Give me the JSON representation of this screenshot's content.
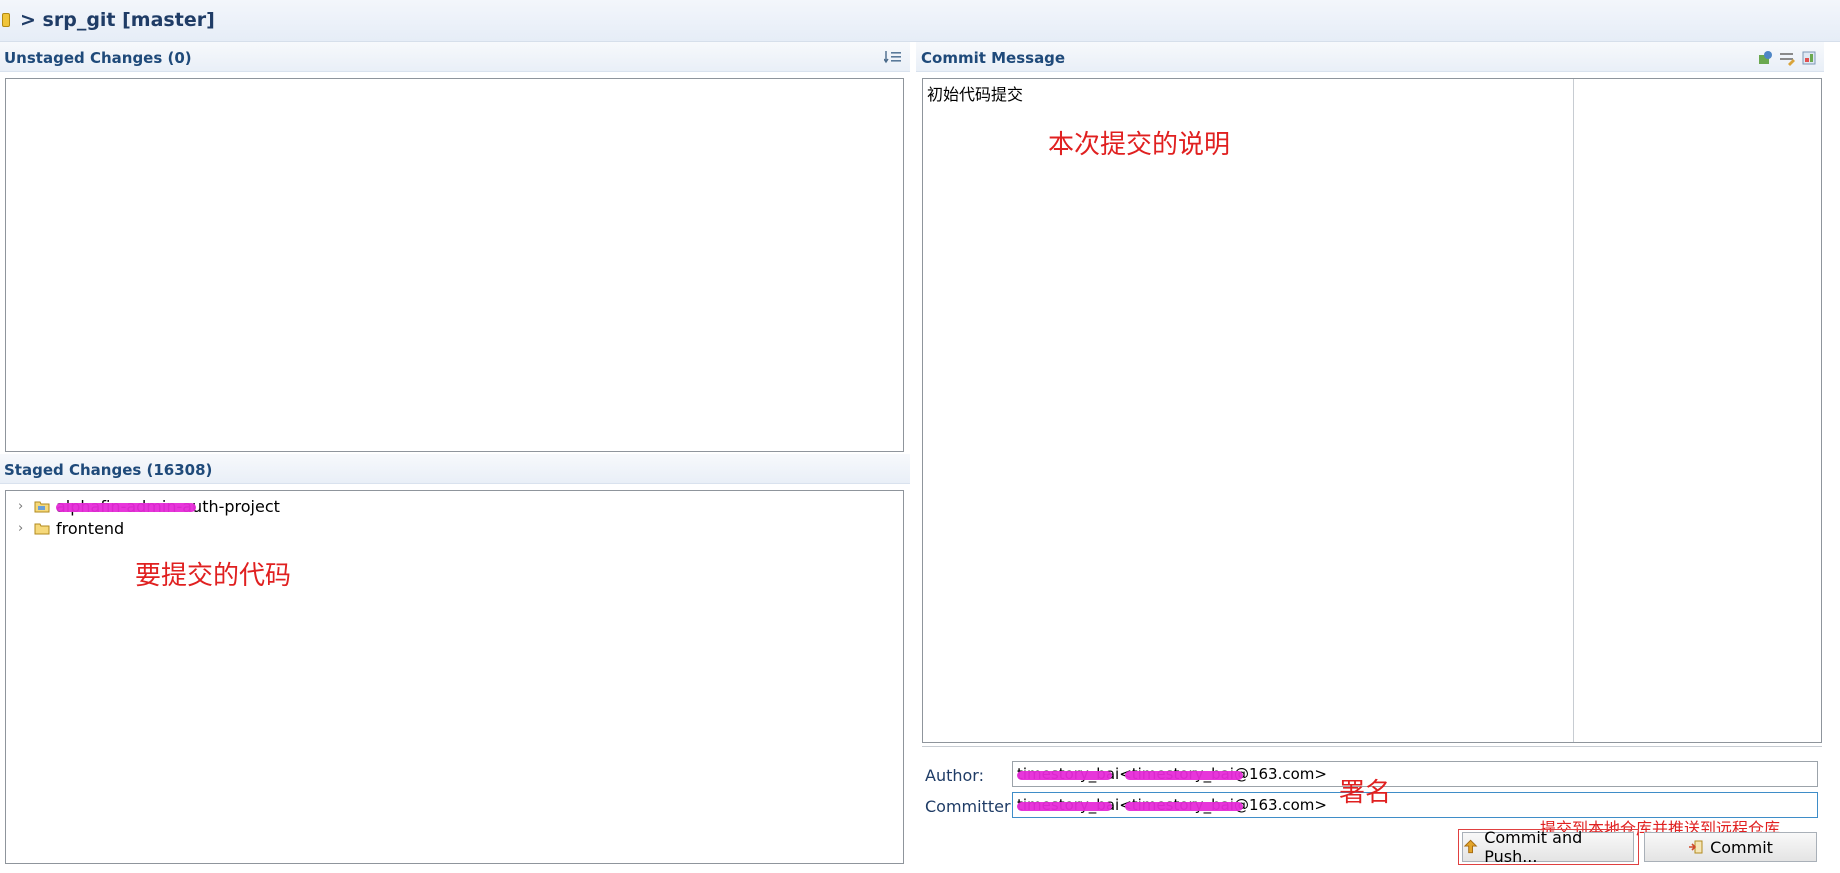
{
  "header": {
    "title": "> srp_git [master]"
  },
  "unstaged": {
    "title": "Unstaged Changes (0)"
  },
  "staged": {
    "title": "Staged Changes (16308)",
    "items": [
      {
        "label": "alphafin-admin-auth-project",
        "icon": "project-folder-icon"
      },
      {
        "label": "frontend",
        "icon": "folder-icon"
      }
    ],
    "annotation": "要提交的代码"
  },
  "commit_message": {
    "title": "Commit Message",
    "text": "初始代码提交",
    "annotation": "本次提交的说明"
  },
  "author": {
    "label": "Author:",
    "value": "timestory_bai<timestory_bai@163.com>"
  },
  "committer": {
    "label": "Committer:",
    "value": "timestory_bai<timestory_bai@163.com>"
  },
  "signature_annotation": "署名",
  "push_annotation": "提交到本地仓库并推送到远程仓库",
  "buttons": {
    "commit_and_push": "Commit and Push...",
    "commit": "Commit"
  },
  "colors": {
    "header_text": "#1f4a7a",
    "annotation": "#e02020",
    "redaction": "#e62bd8"
  }
}
